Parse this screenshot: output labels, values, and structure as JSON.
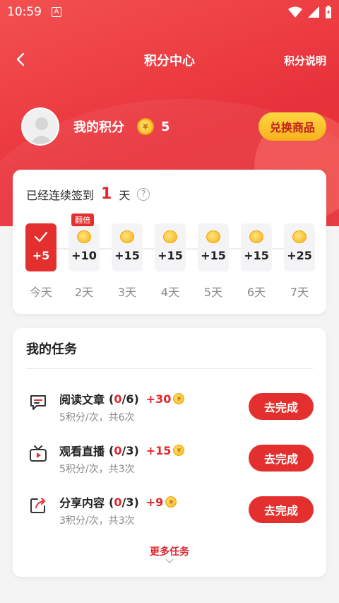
{
  "status_bar": {
    "time": "10:59",
    "notification_icon": "A"
  },
  "nav": {
    "title": "积分中心",
    "explain": "积分说明"
  },
  "user": {
    "points_label": "我的积分",
    "points": "5",
    "exchange_label": "兑换商品"
  },
  "checkin": {
    "prefix": "已经连续签到",
    "days": "1",
    "suffix": "天",
    "help": "?",
    "double_badge": "翻倍",
    "items": [
      {
        "label": "今天",
        "value": "+5",
        "checked": true
      },
      {
        "label": "2天",
        "value": "+10"
      },
      {
        "label": "3天",
        "value": "+15"
      },
      {
        "label": "4天",
        "value": "+15"
      },
      {
        "label": "5天",
        "value": "+15"
      },
      {
        "label": "6天",
        "value": "+15"
      },
      {
        "label": "7天",
        "value": "+25"
      }
    ]
  },
  "tasks": {
    "title": "我的任务",
    "items": [
      {
        "name": "阅读文章",
        "done": "0",
        "total": "/6",
        "reward": "+30",
        "desc": "5积分/次，共6次",
        "button": "去完成",
        "icon": "message-icon"
      },
      {
        "name": "观看直播",
        "done": "0",
        "total": "/3",
        "reward": "+15",
        "desc": "5积分/次，共3次",
        "button": "去完成",
        "icon": "tv-icon"
      },
      {
        "name": "分享内容",
        "done": "0",
        "total": "/3",
        "reward": "+9",
        "desc": "3积分/次，共3次",
        "button": "去完成",
        "icon": "share-icon"
      }
    ],
    "more": "更多任务"
  },
  "colors": {
    "primary": "#e3302f",
    "accent_yellow": "#f7b21b"
  }
}
